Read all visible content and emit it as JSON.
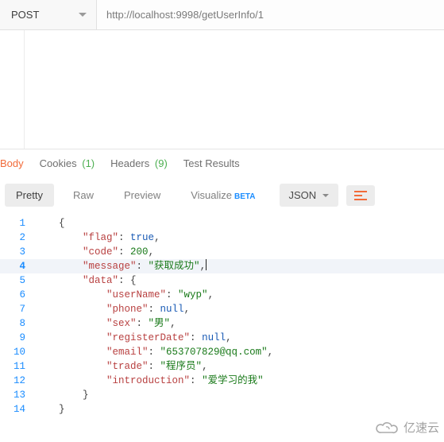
{
  "request": {
    "method": "POST",
    "url": "http://localhost:9998/getUserInfo/1"
  },
  "response_tabs": {
    "body": "Body",
    "cookies": "Cookies",
    "cookies_count": "(1)",
    "headers": "Headers",
    "headers_count": "(9)",
    "test_results": "Test Results"
  },
  "view_toolbar": {
    "pretty": "Pretty",
    "raw": "Raw",
    "preview": "Preview",
    "visualize": "Visualize",
    "beta": "BETA",
    "type": "JSON"
  },
  "json_response": {
    "flag": true,
    "code": 200,
    "message": "获取成功",
    "data": {
      "userName": "wyp",
      "phone": null,
      "sex": "男",
      "registerDate": null,
      "email": "653707829@qq.com",
      "trade": "程序员",
      "introduction": "爱学习的我"
    }
  },
  "lines": {
    "1": "1",
    "2": "2",
    "3": "3",
    "4": "4",
    "5": "5",
    "6": "6",
    "7": "7",
    "8": "8",
    "9": "9",
    "10": "10",
    "11": "11",
    "12": "12",
    "13": "13",
    "14": "14"
  },
  "keys": {
    "flag": "\"flag\"",
    "code": "\"code\"",
    "message": "\"message\"",
    "data": "\"data\"",
    "userName": "\"userName\"",
    "phone": "\"phone\"",
    "sex": "\"sex\"",
    "registerDate": "\"registerDate\"",
    "email": "\"email\"",
    "trade": "\"trade\"",
    "introduction": "\"introduction\""
  },
  "vals": {
    "flag": "true",
    "code": "200",
    "message": "\"获取成功\"",
    "userName": "\"wyp\"",
    "phone": "null",
    "sex": "\"男\"",
    "registerDate": "null",
    "email": "\"653707829@qq.com\"",
    "trade": "\"程序员\"",
    "introduction": "\"爱学习的我\""
  },
  "watermark": "亿速云"
}
